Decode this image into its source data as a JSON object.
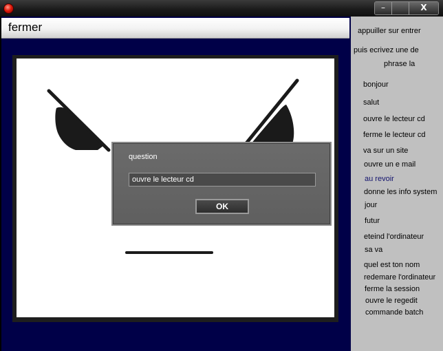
{
  "window": {
    "minimize_symbol": "–",
    "maximize_symbol": "",
    "close_symbol": "X"
  },
  "header": {
    "fermer_label": "fermer"
  },
  "dialog": {
    "title": "question",
    "input_value": "ouvre le lecteur cd",
    "ok_label": "OK"
  },
  "sidebar": {
    "instruction_1": "appuiller sur entrer",
    "instruction_2": "puis ecrivez une de",
    "instruction_3": "phrase la",
    "commands": [
      "bonjour",
      "salut",
      "ouvre le lecteur cd",
      "ferme le lecteur cd",
      "va sur un site",
      "ouvre un e mail",
      "au revoir",
      "donne les info system",
      "jour",
      "futur",
      "eteind l'ordinateur",
      "sa va",
      "quel est ton nom",
      "redemare l'ordinateur",
      "ferme la session",
      "ouvre le regedit",
      "commande batch"
    ],
    "highlighted": "au revoir"
  }
}
